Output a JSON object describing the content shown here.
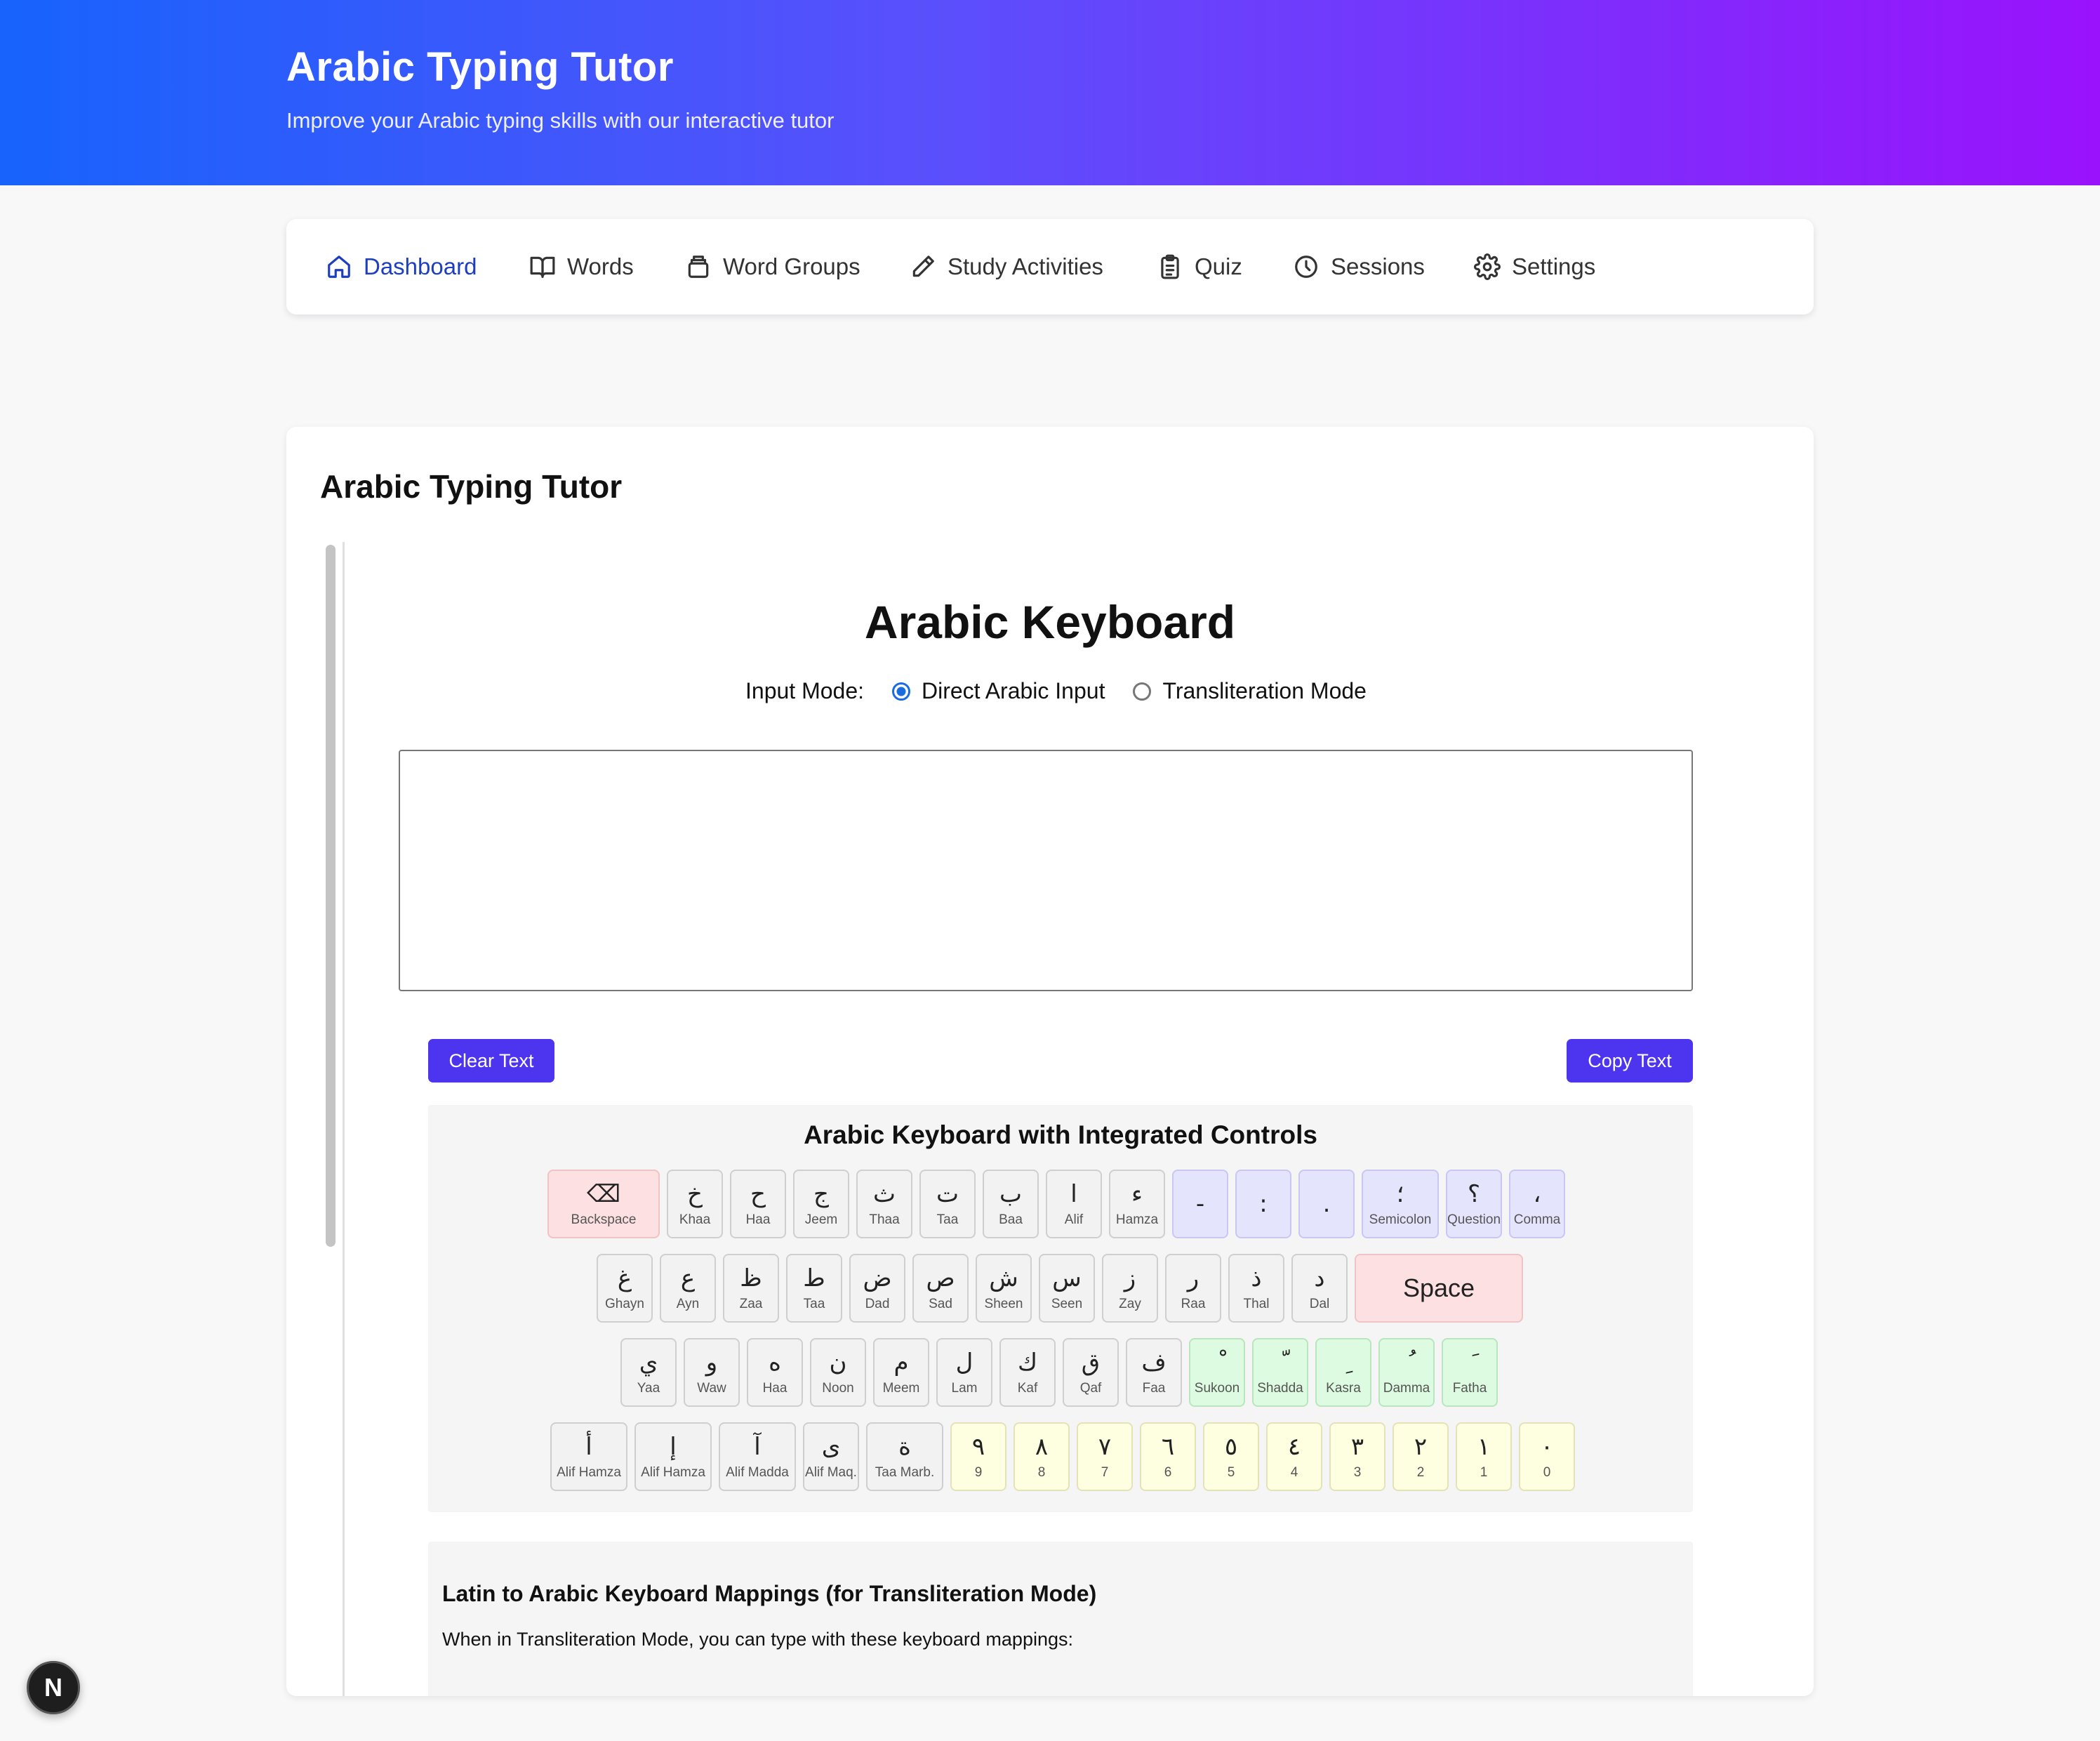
{
  "header": {
    "title": "Arabic Typing Tutor",
    "subtitle": "Improve your Arabic typing skills with our interactive tutor"
  },
  "nav": {
    "items": [
      {
        "label": "Dashboard",
        "icon": "home-icon",
        "active": true
      },
      {
        "label": "Words",
        "icon": "book-icon"
      },
      {
        "label": "Word Groups",
        "icon": "box-icon"
      },
      {
        "label": "Study Activities",
        "icon": "pencil-icon"
      },
      {
        "label": "Quiz",
        "icon": "clipboard-icon"
      },
      {
        "label": "Sessions",
        "icon": "clock-icon"
      },
      {
        "label": "Settings",
        "icon": "gear-icon"
      }
    ]
  },
  "card": {
    "title": "Arabic Typing Tutor",
    "keyboard_title": "Arabic Keyboard",
    "input_mode": {
      "label": "Input Mode:",
      "options": [
        "Direct Arabic Input",
        "Transliteration Mode"
      ],
      "selected": "Direct Arabic Input"
    },
    "textarea_value": "",
    "clear_button": "Clear Text",
    "copy_button": "Copy Text",
    "keyboard_heading": "Arabic Keyboard with Integrated Controls",
    "rows": [
      [
        {
          "ch": "⌫",
          "name": "Backspace",
          "style": "r bk"
        },
        {
          "ch": "خ",
          "name": "Khaa"
        },
        {
          "ch": "ح",
          "name": "Haa"
        },
        {
          "ch": "ج",
          "name": "Jeem"
        },
        {
          "ch": "ث",
          "name": "Thaa"
        },
        {
          "ch": "ت",
          "name": "Taa"
        },
        {
          "ch": "ب",
          "name": "Baa"
        },
        {
          "ch": "ا",
          "name": "Alif"
        },
        {
          "ch": "ء",
          "name": "Hamza"
        },
        {
          "ch": "-",
          "name": "",
          "style": "p"
        },
        {
          "ch": ":",
          "name": "",
          "style": "p"
        },
        {
          "ch": ".",
          "name": "",
          "style": "p"
        },
        {
          "ch": "؛",
          "name": "Semicolon",
          "style": "p wide"
        },
        {
          "ch": "؟",
          "name": "Question",
          "style": "p"
        },
        {
          "ch": "،",
          "name": "Comma",
          "style": "p"
        }
      ],
      [
        {
          "ch": "غ",
          "name": "Ghayn"
        },
        {
          "ch": "ع",
          "name": "Ayn"
        },
        {
          "ch": "ظ",
          "name": "Zaa"
        },
        {
          "ch": "ط",
          "name": "Taa"
        },
        {
          "ch": "ض",
          "name": "Dad"
        },
        {
          "ch": "ص",
          "name": "Sad"
        },
        {
          "ch": "ش",
          "name": "Sheen"
        },
        {
          "ch": "س",
          "name": "Seen"
        },
        {
          "ch": "ز",
          "name": "Zay"
        },
        {
          "ch": "ر",
          "name": "Raa"
        },
        {
          "ch": "ذ",
          "name": "Thal"
        },
        {
          "ch": "د",
          "name": "Dal"
        },
        {
          "ch": "Space",
          "name": "",
          "style": "r space"
        }
      ],
      [
        {
          "ch": "ي",
          "name": "Yaa"
        },
        {
          "ch": "و",
          "name": "Waw"
        },
        {
          "ch": "ه",
          "name": "Haa"
        },
        {
          "ch": "ن",
          "name": "Noon"
        },
        {
          "ch": "م",
          "name": "Meem"
        },
        {
          "ch": "ل",
          "name": "Lam"
        },
        {
          "ch": "ك",
          "name": "Kaf"
        },
        {
          "ch": "ق",
          "name": "Qaf"
        },
        {
          "ch": "ف",
          "name": "Faa"
        },
        {
          "ch": "ْ",
          "name": "Sukoon",
          "style": "g"
        },
        {
          "ch": "ّ",
          "name": "Shadda",
          "style": "g"
        },
        {
          "ch": "ِ",
          "name": "Kasra",
          "style": "g"
        },
        {
          "ch": "ُ",
          "name": "Damma",
          "style": "g"
        },
        {
          "ch": "َ",
          "name": "Fatha",
          "style": "g"
        }
      ],
      [
        {
          "ch": "أ",
          "name": "Alif Hamza",
          "style": "wide"
        },
        {
          "ch": "إ",
          "name": "Alif Hamza",
          "style": "wide"
        },
        {
          "ch": "آ",
          "name": "Alif Madda",
          "style": "wide"
        },
        {
          "ch": "ى",
          "name": "Alif Maq."
        },
        {
          "ch": "ة",
          "name": "Taa Marb.",
          "style": "wide"
        },
        {
          "ch": "٩",
          "name": "9",
          "style": "y"
        },
        {
          "ch": "٨",
          "name": "8",
          "style": "y"
        },
        {
          "ch": "٧",
          "name": "7",
          "style": "y"
        },
        {
          "ch": "٦",
          "name": "6",
          "style": "y"
        },
        {
          "ch": "٥",
          "name": "5",
          "style": "y"
        },
        {
          "ch": "٤",
          "name": "4",
          "style": "y"
        },
        {
          "ch": "٣",
          "name": "3",
          "style": "y"
        },
        {
          "ch": "٢",
          "name": "2",
          "style": "y"
        },
        {
          "ch": "١",
          "name": "1",
          "style": "y"
        },
        {
          "ch": "٠",
          "name": "0",
          "style": "y"
        }
      ]
    ],
    "mappings_title": "Latin to Arabic Keyboard Mappings (for Transliteration Mode)",
    "mappings_desc": "When in Transliteration Mode, you can type with these keyboard mappings:"
  },
  "badge": "N",
  "colors": {
    "header_start": "#1763fc",
    "header_end": "#9a12fc",
    "accent": "#4d35f0",
    "nav_active": "#1d3fbf"
  }
}
